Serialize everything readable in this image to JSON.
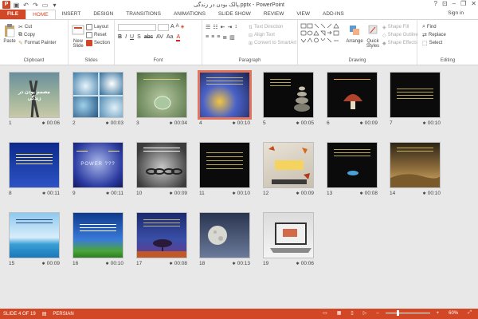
{
  "window": {
    "title": "پالک بودن در زندگی.pptx - PowerPoint",
    "minimize": "–",
    "restore": "❐",
    "close": "✕",
    "help": "?"
  },
  "tabs": [
    {
      "label": "FILE"
    },
    {
      "label": "HOME"
    },
    {
      "label": "INSERT"
    },
    {
      "label": "DESIGN"
    },
    {
      "label": "TRANSITIONS"
    },
    {
      "label": "ANIMATIONS"
    },
    {
      "label": "SLIDE SHOW"
    },
    {
      "label": "REVIEW"
    },
    {
      "label": "VIEW"
    },
    {
      "label": "ADD-INS"
    }
  ],
  "signin": "Sign in",
  "ribbon": {
    "clipboard": {
      "paste": "Paste",
      "cut": "Cut",
      "copy": "Copy",
      "format_painter": "Format Painter",
      "label": "Clipboard"
    },
    "slides": {
      "new_slide": "New Slide",
      "layout": "Layout",
      "reset": "Reset",
      "section": "Section",
      "label": "Slides"
    },
    "font": {
      "label": "Font"
    },
    "paragraph": {
      "text_direction": "Text Direction",
      "align_text": "Align Text",
      "smartart": "Convert to SmartArt",
      "label": "Paragraph"
    },
    "drawing": {
      "arrange": "Arrange",
      "quick_styles": "Quick Styles",
      "shape_fill": "Shape Fill",
      "shape_outline": "Shape Outline",
      "shape_effects": "Shape Effects",
      "label": "Drawing"
    },
    "editing": {
      "find": "Find",
      "replace": "Replace",
      "select": "Select",
      "label": "Editing"
    }
  },
  "slides": [
    {
      "num": "1",
      "time": "00:06"
    },
    {
      "num": "2",
      "time": "00:03"
    },
    {
      "num": "3",
      "time": "00:04"
    },
    {
      "num": "4",
      "time": "00:10"
    },
    {
      "num": "5",
      "time": "00:05"
    },
    {
      "num": "6",
      "time": "00:09"
    },
    {
      "num": "7",
      "time": "00:10"
    },
    {
      "num": "8",
      "time": "00:11"
    },
    {
      "num": "9",
      "time": "00:11"
    },
    {
      "num": "10",
      "time": "00:09"
    },
    {
      "num": "11",
      "time": "00:10"
    },
    {
      "num": "12",
      "time": "00:09"
    },
    {
      "num": "13",
      "time": "00:08"
    },
    {
      "num": "14",
      "time": "00:10"
    },
    {
      "num": "15",
      "time": "00:09"
    },
    {
      "num": "16",
      "time": "00:10"
    },
    {
      "num": "17",
      "time": "00:08"
    },
    {
      "num": "18",
      "time": "00:13"
    },
    {
      "num": "19",
      "time": "00:06"
    }
  ],
  "slide1_caption": "مصمم بودن در زندگی",
  "slide9_caption": "POWER ???",
  "status": {
    "slide_of": "SLIDE 4 OF 19",
    "language": "PERSIAN",
    "zoom": "60%",
    "zoom_level": 0.6
  },
  "colors": {
    "accent": "#d24726",
    "ribbon_bg": "#ffffff",
    "sorter_bg": "#e8e8e8",
    "selected_border": "#e2745a"
  }
}
